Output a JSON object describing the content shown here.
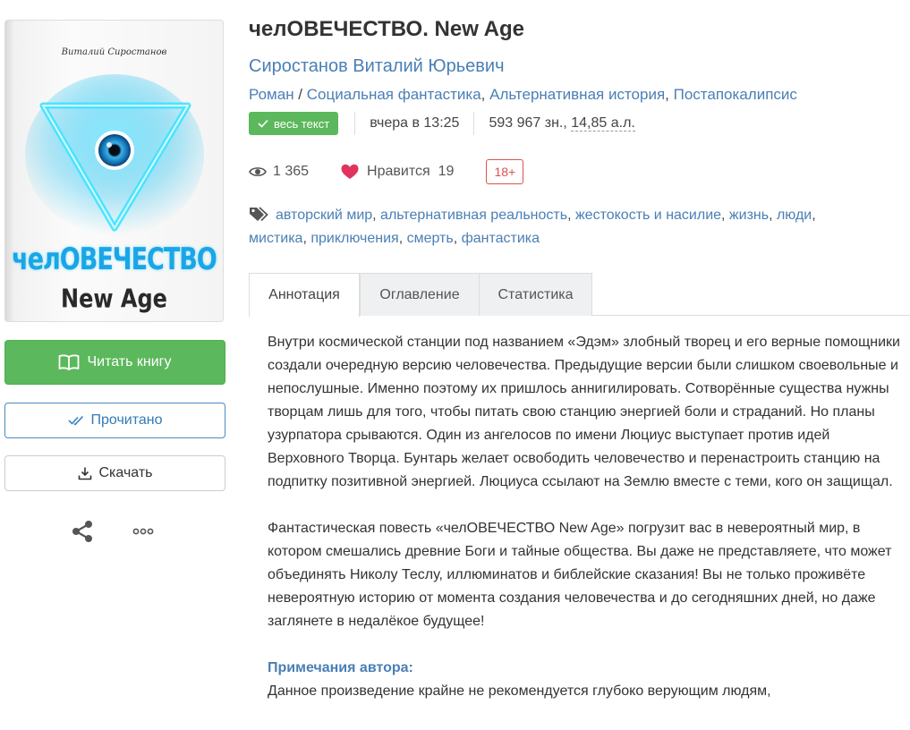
{
  "cover": {
    "author": "Виталий Сиростанов",
    "title_line1": "челОВЕЧЕСТВО",
    "title_line2": "New Age"
  },
  "sidebar": {
    "read_label": "Читать книгу",
    "done_label": "Прочитано",
    "download_label": "Скачать"
  },
  "book": {
    "title": "челОВЕЧЕСТВО. New Age",
    "author": "Сиростанов Виталий Юрьевич",
    "genres": [
      "Роман",
      "Социальная фантастика",
      "Альтернативная история",
      "Постапокалипсис"
    ],
    "full_text_badge": "весь текст",
    "updated": "вчера в 13:25",
    "size_chars": "593 967 зн., ",
    "size_al": "14,85 а.л.",
    "views": "1 365",
    "likes_label": "Нравится",
    "likes_count": "19",
    "age_rating": "18+"
  },
  "tags": [
    "авторский мир",
    "альтернативная реальность",
    "жестокость и насилие",
    "жизнь",
    "люди",
    "мистика",
    "приключения",
    "смерть",
    "фантастика"
  ],
  "tabs": {
    "annotation": "Аннотация",
    "contents": "Оглавление",
    "statistics": "Статистика"
  },
  "annotation": {
    "p1": "Внутри космической станции под названием «Эдэм» злобный творец и его верные помощники создали очередную версию человечества. Предыдущие версии были слишком своевольные и непослушные. Именно поэтому их пришлось аннигилировать. Сотворённые существа нужны творцам лишь для того, чтобы питать свою станцию энергией боли и страданий. Но планы узурпатора срываются. Один из ангелосов по имени Люциус выступает против идей Верховного Творца. Бунтарь желает освободить человечество и перенастроить станцию на подпитку позитивной энергией. Люциуса ссылают на Землю вместе с теми, кого он защищал.",
    "p2": "Фантастическая повесть «челОВЕЧЕСТВО New Age» погрузит вас в невероятный мир, в котором смешались древние Боги и тайные общества. Вы даже не представляете, что может объединять Николу Теслу, иллюминатов и библейские сказания! Вы не только проживёте невероятную историю от момента создания человечества и до сегодняшних дней, но даже заглянете в недалёкое будущее!",
    "notes_title": "Примечания автора:",
    "notes_text": "Данное произведение крайне не рекомендуется глубоко верующим людям,"
  },
  "colors": {
    "link": "#4a7fb5",
    "success": "#5cb85c",
    "danger": "#d9534f"
  },
  "icons": [
    "book-open-icon",
    "double-check-icon",
    "download-icon",
    "share-icon",
    "more-icon",
    "check-icon",
    "eye-icon",
    "heart-icon",
    "tags-icon"
  ]
}
